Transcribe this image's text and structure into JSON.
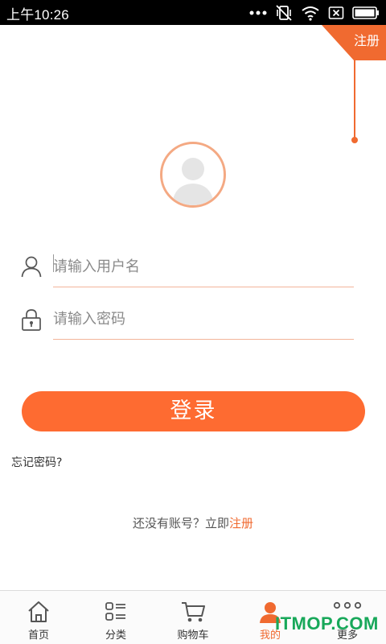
{
  "status_bar": {
    "time": "上午10:26",
    "icons": [
      "more-dots-icon",
      "vibrate-off-icon",
      "wifi-icon",
      "sim-x-icon",
      "battery-icon"
    ]
  },
  "register_ribbon": {
    "label": "注册"
  },
  "avatar": {
    "icon": "user-avatar-icon"
  },
  "login_form": {
    "username": {
      "placeholder": "请输入用户名",
      "value": "",
      "icon": "user-icon"
    },
    "password": {
      "placeholder": "请输入密码",
      "value": "",
      "icon": "lock-icon"
    },
    "login_label": "登录",
    "forgot_label": "忘记密码?"
  },
  "signup_prompt": {
    "text": "还没有账号？立即",
    "link": "注册"
  },
  "bottom_nav": {
    "active_index": 3,
    "items": [
      {
        "label": "首页",
        "icon": "home-icon"
      },
      {
        "label": "分类",
        "icon": "category-icon"
      },
      {
        "label": "购物车",
        "icon": "cart-icon"
      },
      {
        "label": "我的",
        "icon": "profile-icon"
      },
      {
        "label": "更多",
        "icon": "more-icon"
      }
    ]
  },
  "watermark": {
    "text": "ITMOP.COM"
  },
  "colors": {
    "accent": "#fe6b31",
    "link": "#f06a30",
    "watermark": "#18a85a"
  }
}
